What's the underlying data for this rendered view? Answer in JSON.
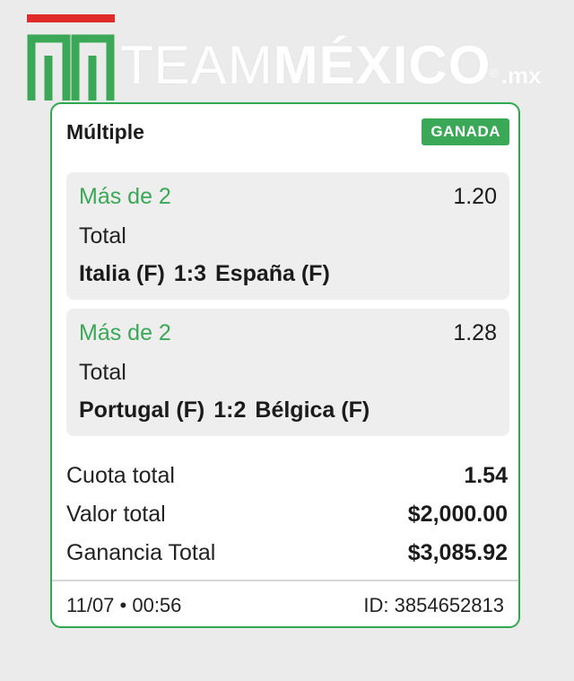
{
  "logo": {
    "text_light": "TEAM",
    "text_bold": "MÉXICO",
    "reg": "®",
    "suffix": ".mx",
    "colors": {
      "red_bar": "#e12b2b",
      "green_mark": "#3aa856"
    }
  },
  "bet": {
    "type": "Múltiple",
    "status": "GANADA",
    "selections": [
      {
        "market": "Más de 2",
        "odds": "1.20",
        "kind": "Total",
        "home": "Italia (F)",
        "score": "1:3",
        "away": "España (F)"
      },
      {
        "market": "Más de 2",
        "odds": "1.28",
        "kind": "Total",
        "home": "Portugal (F)",
        "score": "1:2",
        "away": "Bélgica (F)"
      }
    ],
    "summary": [
      {
        "label": "Cuota total",
        "value": "1.54"
      },
      {
        "label": "Valor total",
        "value": "$2,000.00"
      },
      {
        "label": "Ganancia Total",
        "value": "$3,085.92"
      }
    ],
    "footer": {
      "datetime": "11/07 • 00:56",
      "id": "ID: 3854652813"
    }
  },
  "colors": {
    "accent_green": "#3aa856",
    "card_border": "#2fa84f",
    "selection_bg": "#eeeeee",
    "page_bg": "#ebebeb"
  }
}
